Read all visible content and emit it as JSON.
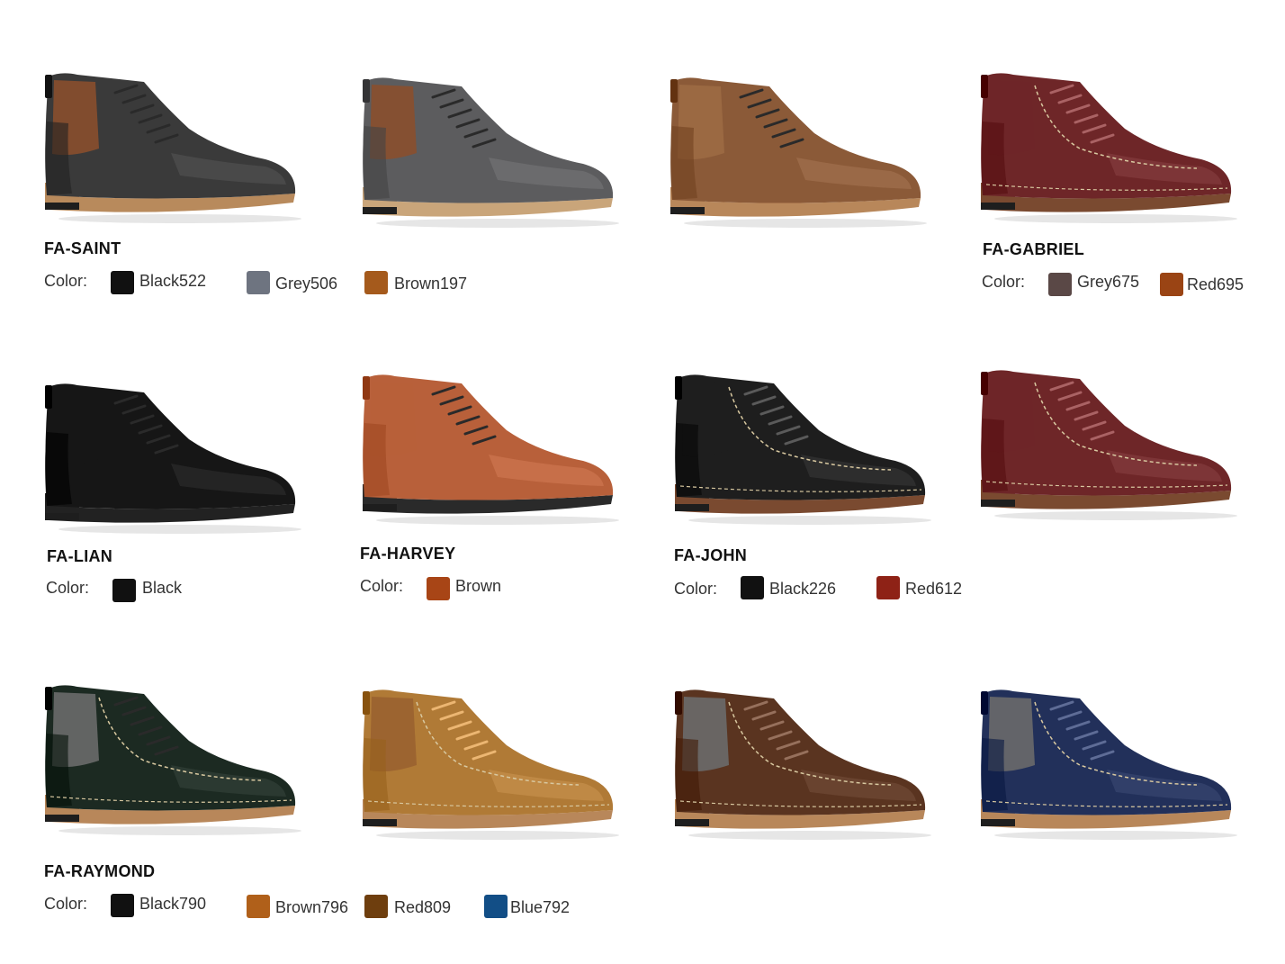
{
  "color_label": "Color:",
  "shoes": [
    {
      "upper": "#3a3a3a",
      "accent": "#8a4f2e",
      "sole": "#b88a5c",
      "stitch": false
    },
    {
      "upper": "#5c5c5e",
      "accent": "#8a4f2e",
      "sole": "#c9a57a",
      "stitch": false
    },
    {
      "upper": "#8b5a38",
      "accent": "#9c6a44",
      "sole": "#b8875a",
      "stitch": false
    },
    {
      "upper": "#6e2628",
      "accent": "#6e2628",
      "sole": "#7a4a30",
      "stitch": true
    },
    {
      "upper": "#161616",
      "accent": "#161616",
      "sole": "#222222",
      "stitch": false
    },
    {
      "upper": "#b8603a",
      "accent": "#b8603a",
      "sole": "#2a2a2a",
      "stitch": false
    },
    {
      "upper": "#1e1e1e",
      "accent": "#1e1e1e",
      "sole": "#7a4a30",
      "stitch": true
    },
    {
      "upper": "#6e2628",
      "accent": "#6e2628",
      "sole": "#7a4a30",
      "stitch": true
    },
    {
      "upper": "#1c2a22",
      "accent": "#6a6a6a",
      "sole": "#b8875a",
      "stitch": true
    },
    {
      "upper": "#b07a36",
      "accent": "#9a6230",
      "sole": "#b8875a",
      "stitch": true
    },
    {
      "upper": "#5a3420",
      "accent": "#6a6a6a",
      "sole": "#b8875a",
      "stitch": true
    },
    {
      "upper": "#22305a",
      "accent": "#6a6a6a",
      "sole": "#b8875a",
      "stitch": true
    }
  ],
  "models": [
    {
      "name": "FA-SAINT",
      "colors": [
        {
          "label": "Black522",
          "hex": "#111111"
        },
        {
          "label": "Grey506",
          "hex": "#6e7480"
        },
        {
          "label": "Brown197",
          "hex": "#a55a1c"
        }
      ]
    },
    {
      "name": "FA-GABRIEL",
      "colors": [
        {
          "label": "Grey675",
          "hex": "#5a4846"
        },
        {
          "label": "Red695",
          "hex": "#9a4414"
        }
      ]
    },
    {
      "name": "FA-LIAN",
      "colors": [
        {
          "label": "Black",
          "hex": "#111111"
        }
      ]
    },
    {
      "name": "FA-HARVEY",
      "colors": [
        {
          "label": "Brown",
          "hex": "#a84516"
        }
      ]
    },
    {
      "name": "FA-JOHN",
      "colors": [
        {
          "label": "Black226",
          "hex": "#111111"
        },
        {
          "label": "Red612",
          "hex": "#8e2216"
        }
      ]
    },
    {
      "name": "FA-RAYMOND",
      "colors": [
        {
          "label": "Black790",
          "hex": "#111111"
        },
        {
          "label": "Brown796",
          "hex": "#b0601a"
        },
        {
          "label": "Red809",
          "hex": "#6e3e0e"
        },
        {
          "label": "Blue792",
          "hex": "#124e86"
        }
      ]
    }
  ]
}
